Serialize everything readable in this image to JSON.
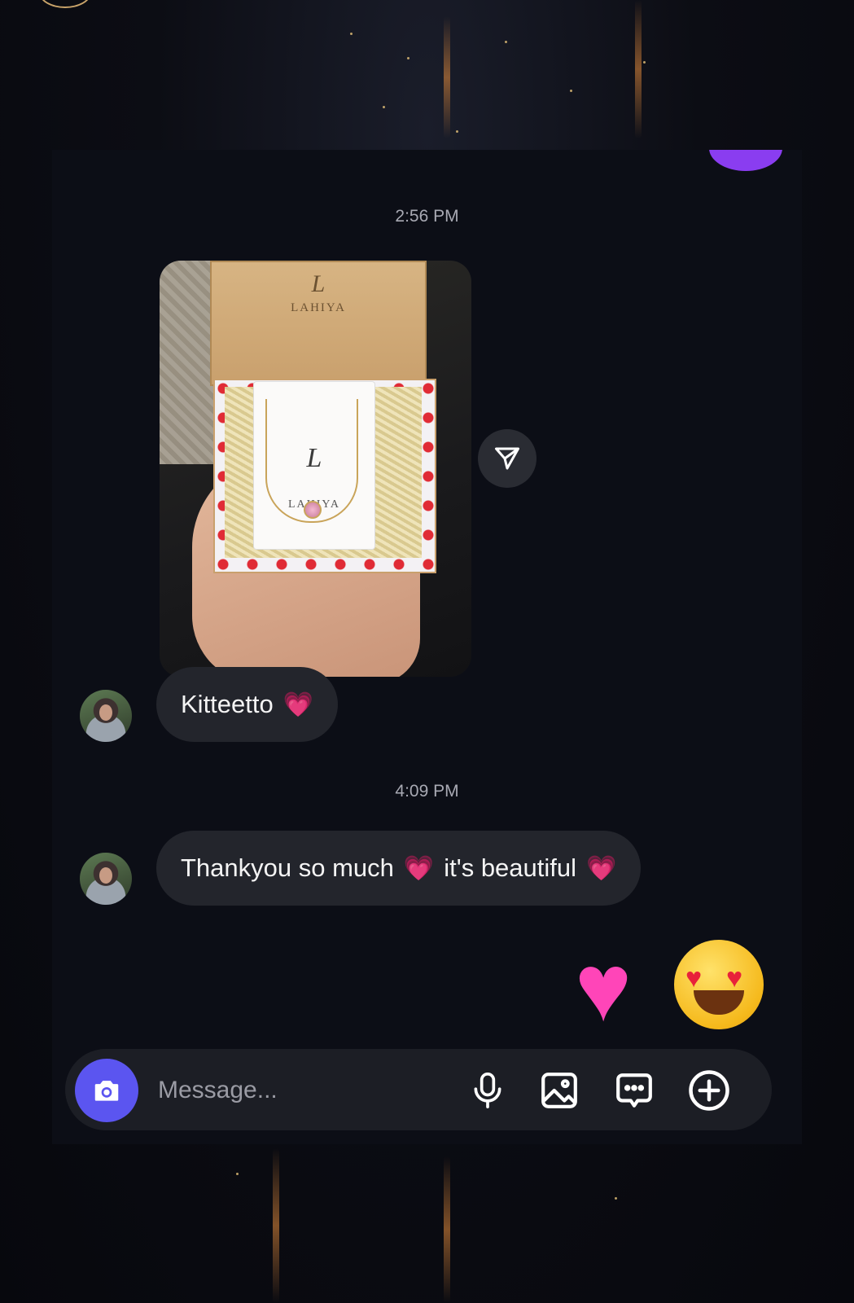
{
  "conversation": {
    "timestamps": [
      "2:56 PM",
      "4:09 PM"
    ],
    "photo": {
      "box_logo": "L",
      "box_brand": "LAHIYA",
      "card_logo": "L",
      "card_brand": "LAHIYA"
    },
    "messages": [
      {
        "text": "Kitteetto",
        "emoji": "💗"
      },
      {
        "text_before": "Thankyou so much",
        "emoji_mid": "💗",
        "text_after": "it's beautiful",
        "emoji_end": "💗"
      }
    ],
    "sent_reaction": {
      "heart": "♥",
      "emoji": "heart-eyes"
    }
  },
  "composer": {
    "placeholder": "Message...",
    "icons": [
      "camera-icon",
      "microphone-icon",
      "gallery-icon",
      "sticker-chat-icon",
      "add-icon"
    ]
  },
  "colors": {
    "accent": "#5b55f0",
    "bubble": "#23252c",
    "heart": "#ff3fb4"
  }
}
